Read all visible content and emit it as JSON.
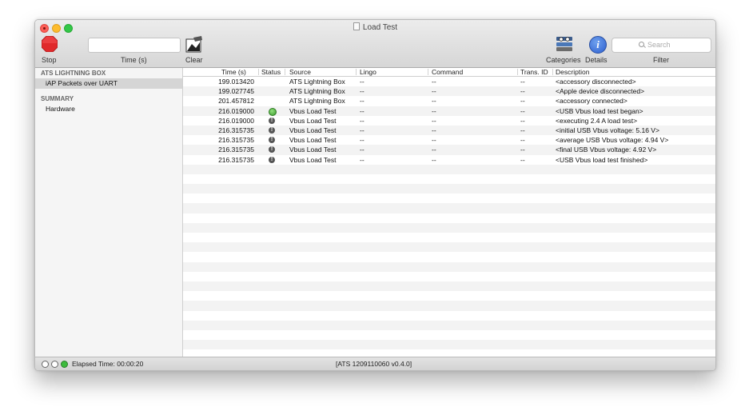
{
  "window": {
    "title": "Load Test",
    "controls": [
      "close",
      "minimize",
      "maximize"
    ]
  },
  "toolbar": {
    "stop_label": "Stop",
    "time_label": "Time (s)",
    "time_value": "",
    "clear_label": "Clear",
    "categories_label": "Categories",
    "details_label": "Details",
    "filter_label": "Filter",
    "search_placeholder": "Search",
    "details_glyph": "i",
    "stop_color": "#e0292b"
  },
  "sidebar": {
    "section1_title": "ATS LIGHTNING BOX",
    "section1_items": [
      "iAP Packets over UART"
    ],
    "section2_title": "SUMMARY",
    "section2_items": [
      "Hardware"
    ]
  },
  "table": {
    "columns": [
      "Time (s)",
      "Status",
      "Source",
      "Lingo",
      "Command",
      "Trans. ID",
      "Description"
    ],
    "rows": [
      {
        "time": "199.013420",
        "status": "",
        "source": "ATS Lightning Box",
        "lingo": "--",
        "command": "--",
        "trans_id": "--",
        "description": "<accessory disconnected>"
      },
      {
        "time": "199.027745",
        "status": "",
        "source": "ATS Lightning Box",
        "lingo": "--",
        "command": "--",
        "trans_id": "--",
        "description": "<Apple device disconnected>"
      },
      {
        "time": "201.457812",
        "status": "",
        "source": "ATS Lightning Box",
        "lingo": "--",
        "command": "--",
        "trans_id": "--",
        "description": "<accessory connected>"
      },
      {
        "time": "216.019000",
        "status": "ok",
        "source": "Vbus Load Test",
        "lingo": "--",
        "command": "--",
        "trans_id": "--",
        "description": "<USB Vbus load test began>"
      },
      {
        "time": "216.019000",
        "status": "info",
        "source": "Vbus Load Test",
        "lingo": "--",
        "command": "--",
        "trans_id": "--",
        "description": "<executing 2.4 A load test>"
      },
      {
        "time": "216.315735",
        "status": "info",
        "source": "Vbus Load Test",
        "lingo": "--",
        "command": "--",
        "trans_id": "--",
        "description": "<initial USB Vbus voltage: 5.16 V>"
      },
      {
        "time": "216.315735",
        "status": "info",
        "source": "Vbus Load Test",
        "lingo": "--",
        "command": "--",
        "trans_id": "--",
        "description": "<average USB Vbus voltage: 4.94 V>"
      },
      {
        "time": "216.315735",
        "status": "info",
        "source": "Vbus Load Test",
        "lingo": "--",
        "command": "--",
        "trans_id": "--",
        "description": "<final USB Vbus voltage: 4.92 V>"
      },
      {
        "time": "216.315735",
        "status": "info",
        "source": "Vbus Load Test",
        "lingo": "--",
        "command": "--",
        "trans_id": "--",
        "description": "<USB Vbus load test finished>"
      }
    ],
    "empty_rows": 20
  },
  "statusbar": {
    "elapsed": "Elapsed Time: 00:00:20",
    "version": "[ATS 1209110060 v0.4.0]"
  }
}
